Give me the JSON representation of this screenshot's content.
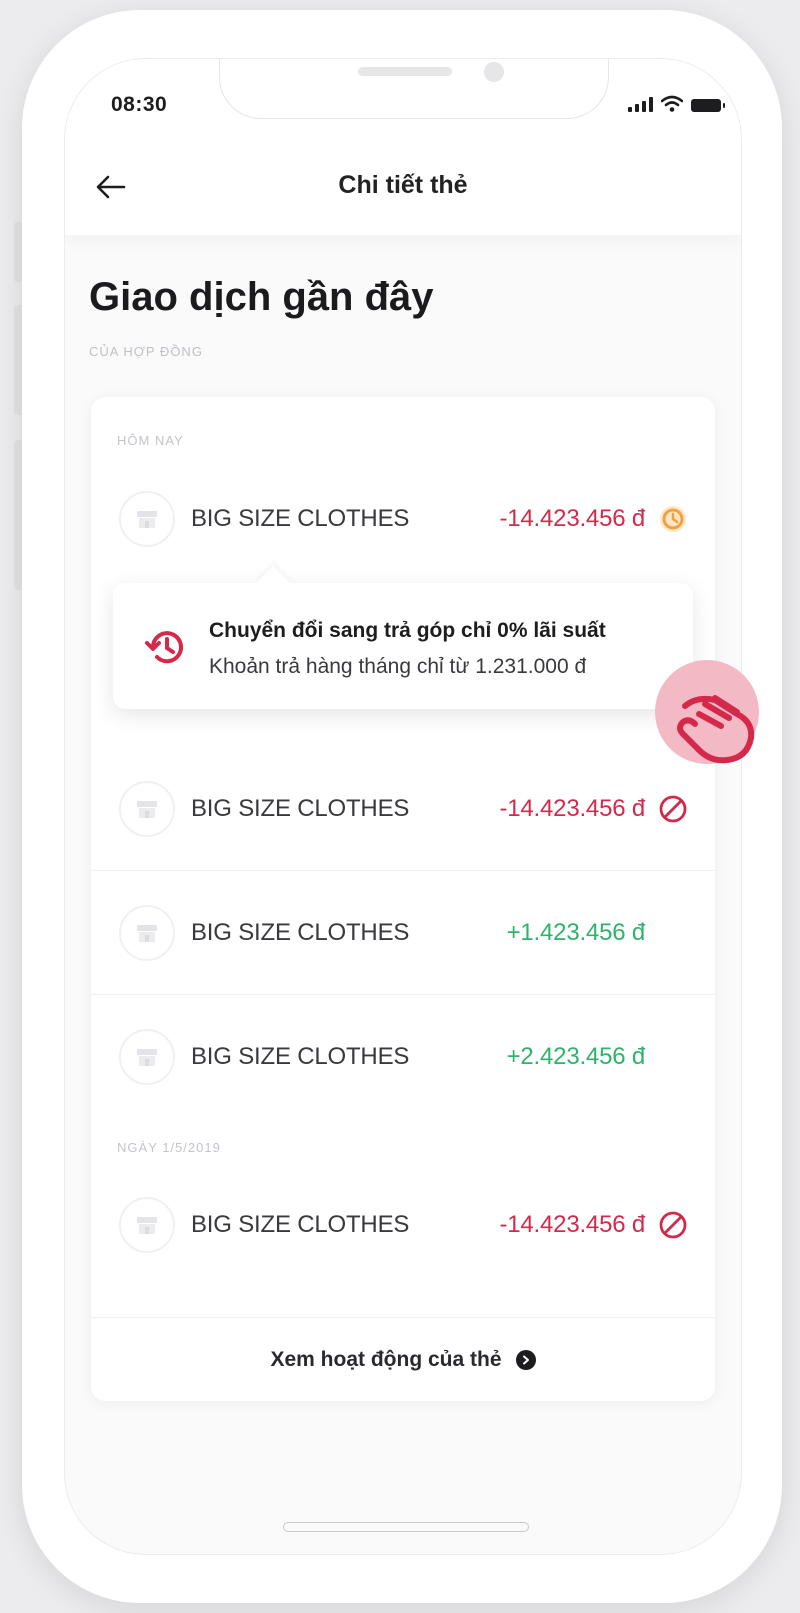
{
  "status": {
    "time": "08:30"
  },
  "header": {
    "title": "Chi tiết thẻ"
  },
  "section": {
    "title": "Giao dịch gần đây",
    "subtitle": "CỦA HỢP ĐỒNG"
  },
  "groups": [
    {
      "label": "HÔM NAY"
    },
    {
      "label": "NGÀY 1/5/2019"
    }
  ],
  "transactions": [
    {
      "name": "BIG SIZE CLOTHES",
      "amount": "-14.423.456 đ",
      "status": "pending-clock-icon"
    },
    {
      "name": "BIG SIZE CLOTHES",
      "amount": "-14.423.456 đ",
      "status": "blocked-icon"
    },
    {
      "name": "BIG SIZE CLOTHES",
      "amount": "+1.423.456 đ"
    },
    {
      "name": "BIG SIZE CLOTHES",
      "amount": "+2.423.456 đ"
    },
    {
      "name": "BIG SIZE CLOTHES",
      "amount": "-14.423.456 đ",
      "status": "blocked-icon"
    }
  ],
  "tooltip": {
    "title": "Chuyển đổi sang trả góp chỉ 0% lãi suất",
    "text": "Khoản trả hàng tháng chỉ từ 1.231.000 đ"
  },
  "footer": {
    "view_more": "Xem hoạt động của thẻ"
  },
  "colors": {
    "negative": "#d4294b",
    "positive": "#2fb36b",
    "pending": "#f2a23a",
    "accent": "#d4294b"
  }
}
